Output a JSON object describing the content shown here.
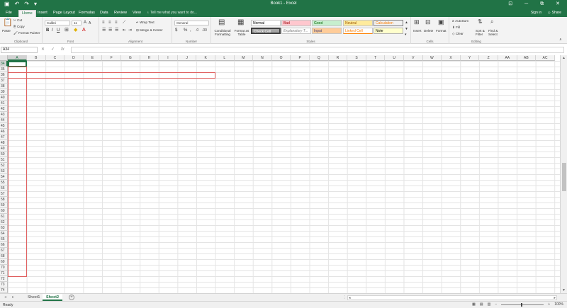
{
  "app": {
    "title": "Book1 - Excel"
  },
  "qat": {
    "save_icon": "save-icon",
    "undo": "↶",
    "redo": "↷"
  },
  "window": {
    "minimize": "▭",
    "restore": "⧉",
    "close": "✕",
    "ribbon_opts": "⊡"
  },
  "account": {
    "sign_in": "Sign in",
    "share": "Share"
  },
  "tabs": [
    "File",
    "Home",
    "Insert",
    "Page Layout",
    "Formulas",
    "Data",
    "Review",
    "View"
  ],
  "active_tab": "Home",
  "tellme": "Tell me what you want to do...",
  "ribbon": {
    "clipboard": {
      "paste": "Paste",
      "cut": "Cut",
      "copy": "Copy",
      "format_painter": "Format Painter",
      "name": "Clipboard"
    },
    "font": {
      "family": "Calibri",
      "size": "11",
      "bold": "B",
      "italic": "I",
      "underline": "U",
      "grow": "A",
      "shrink": "A",
      "name": "Font"
    },
    "alignment": {
      "wrap_text": "Wrap Text",
      "merge_center": "Merge & Center",
      "name": "Alignment"
    },
    "number": {
      "format": "General",
      "percent": "%",
      "comma": ",",
      "name": "Number"
    },
    "styles": {
      "conditional": "Conditional Formatting",
      "format_table": "Format as Table",
      "cells": [
        {
          "label": "Normal"
        },
        {
          "label": "Bad"
        },
        {
          "label": "Good"
        },
        {
          "label": "Neutral"
        },
        {
          "label": "Calculation"
        },
        {
          "label": "Check Cell"
        },
        {
          "label": "Explanatory T..."
        },
        {
          "label": "Input"
        },
        {
          "label": "Linked Cell"
        },
        {
          "label": "Note"
        }
      ],
      "name": "Styles"
    },
    "cells_group": {
      "insert": "Insert",
      "delete": "Delete",
      "format": "Format",
      "name": "Cells"
    },
    "editing": {
      "autosum": "AutoSum",
      "fill": "Fill",
      "clear": "Clear",
      "sort_filter": "Sort & Filter",
      "find_select": "Find & Select",
      "name": "Editing"
    }
  },
  "formula_bar": {
    "name_box": "A34",
    "cancel": "✕",
    "enter": "✓",
    "fx": "fx",
    "value": ""
  },
  "columns": [
    "A",
    "B",
    "C",
    "D",
    "E",
    "F",
    "G",
    "H",
    "I",
    "J",
    "K",
    "L",
    "M",
    "N",
    "O",
    "P",
    "Q",
    "R",
    "S",
    "T",
    "U",
    "V",
    "W",
    "X",
    "Y",
    "Z",
    "AA",
    "AB",
    "AC"
  ],
  "rows": [
    "34",
    "35",
    "36",
    "37",
    "38",
    "39",
    "40",
    "41",
    "42",
    "43",
    "44",
    "45",
    "46",
    "47",
    "48",
    "49",
    "50",
    "51",
    "52",
    "53",
    "54",
    "55",
    "56",
    "57",
    "58",
    "59",
    "60",
    "61",
    "62",
    "63",
    "64",
    "65",
    "66",
    "67",
    "68",
    "69",
    "70",
    "71",
    "72",
    "73",
    "74"
  ],
  "selected_cell": "A34",
  "sheets": [
    "Sheet1",
    "Sheet2"
  ],
  "active_sheet": "Sheet2",
  "status": {
    "ready": "Ready",
    "zoom": "100%",
    "zoom_minus": "−",
    "zoom_plus": "+"
  },
  "colors": {
    "accent": "#217346"
  }
}
